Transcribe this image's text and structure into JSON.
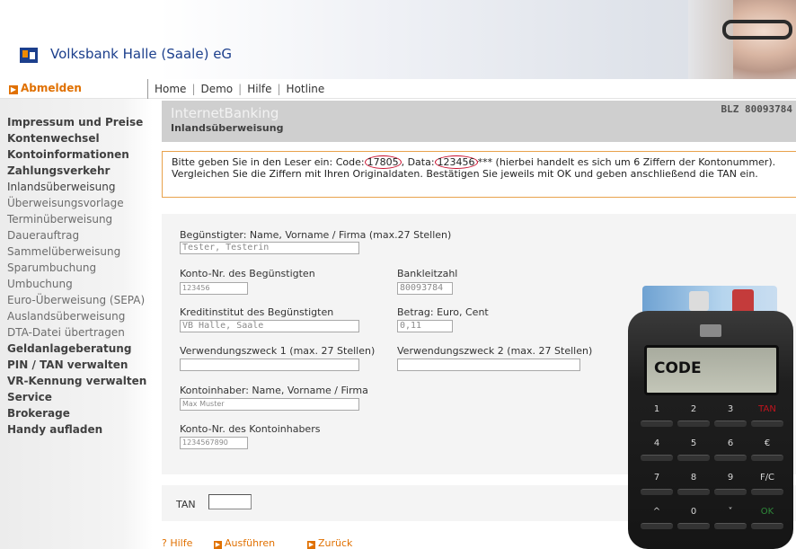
{
  "header": {
    "bank_name": "Volksbank Halle (Saale) eG",
    "logo_icon": "volksbank-logo-icon"
  },
  "topnav": {
    "logout": "Abmelden",
    "links": [
      "Home",
      "Demo",
      "Hilfe",
      "Hotline"
    ]
  },
  "sidebar": {
    "items": [
      {
        "label": "Impressum und Preise",
        "kind": "main"
      },
      {
        "label": "Kontenwechsel",
        "kind": "main"
      },
      {
        "label": "Kontoinformationen",
        "kind": "main"
      },
      {
        "label": "Zahlungsverkehr",
        "kind": "main"
      },
      {
        "label": "Inlandsüberweisung",
        "kind": "active"
      },
      {
        "label": "Überweisungsvorlage",
        "kind": "sub"
      },
      {
        "label": "Terminüberweisung",
        "kind": "sub"
      },
      {
        "label": "Dauerauftrag",
        "kind": "sub"
      },
      {
        "label": "Sammelüberweisung",
        "kind": "sub"
      },
      {
        "label": "Sparumbuchung",
        "kind": "sub"
      },
      {
        "label": "Umbuchung",
        "kind": "sub"
      },
      {
        "label": "Euro-Überweisung (SEPA)",
        "kind": "sub"
      },
      {
        "label": "Auslandsüberweisung",
        "kind": "sub"
      },
      {
        "label": "DTA-Datei übertragen",
        "kind": "sub"
      },
      {
        "label": "Geldanlageberatung",
        "kind": "main"
      },
      {
        "label": "PIN / TAN verwalten",
        "kind": "main"
      },
      {
        "label": "VR-Kennung verwalten",
        "kind": "main"
      },
      {
        "label": "Service",
        "kind": "main"
      },
      {
        "label": "Brokerage",
        "kind": "main"
      },
      {
        "label": "Handy aufladen",
        "kind": "main"
      }
    ]
  },
  "main": {
    "title": "InternetBanking",
    "subtitle": "Inlandsüberweisung",
    "blz": "BLZ 80093784"
  },
  "instruction": {
    "part1": "Bitte geben Sie in den Leser ein: Code:",
    "code": "17805",
    "part2": ", Data:",
    "data": "123456",
    "part3": "*** (hierbei handelt es sich um 6 Ziffern der Kontonummer). Vergleichen Sie die Ziffern mit Ihren Originaldaten. Bestätigen Sie jeweils mit OK und geben anschließend die TAN ein."
  },
  "form": {
    "payee_label": "Begünstigter: Name, Vorname / Firma (max.27 Stellen)",
    "payee_value": "Tester, Testerin",
    "payee_account_label": "Konto-Nr. des Begünstigten",
    "payee_account_value": "123456",
    "bank_code_label": "Bankleitzahl",
    "bank_code_value": "80093784",
    "credit_inst_label": "Kreditinstitut des Begünstigten",
    "credit_inst_value": "VB Halle, Saale",
    "amount_label": "Betrag: Euro, Cent",
    "amount_value": "0,11",
    "purpose1_label": "Verwendungszweck 1 (max. 27 Stellen)",
    "purpose1_value": "",
    "purpose2_label": "Verwendungszweck 2 (max. 27 Stellen)",
    "purpose2_value": "",
    "holder_label": "Kontoinhaber: Name, Vorname / Firma",
    "holder_value": "Max Muster",
    "holder_account_label": "Konto-Nr. des Kontoinhabers",
    "holder_account_value": "1234567890",
    "tan_label": "TAN",
    "tan_value": ""
  },
  "actions": {
    "help": "Hilfe",
    "execute": "Ausführen",
    "back": "Zurück"
  },
  "device": {
    "screen": "CODE",
    "keys": [
      "1",
      "2",
      "3",
      "TAN",
      "4",
      "5",
      "6",
      "€",
      "7",
      "8",
      "9",
      "F/C",
      "^",
      "0",
      "˅",
      "OK"
    ],
    "key_colors": {
      "TAN": "#c0141e",
      "OK": "#2f8a3a"
    }
  }
}
